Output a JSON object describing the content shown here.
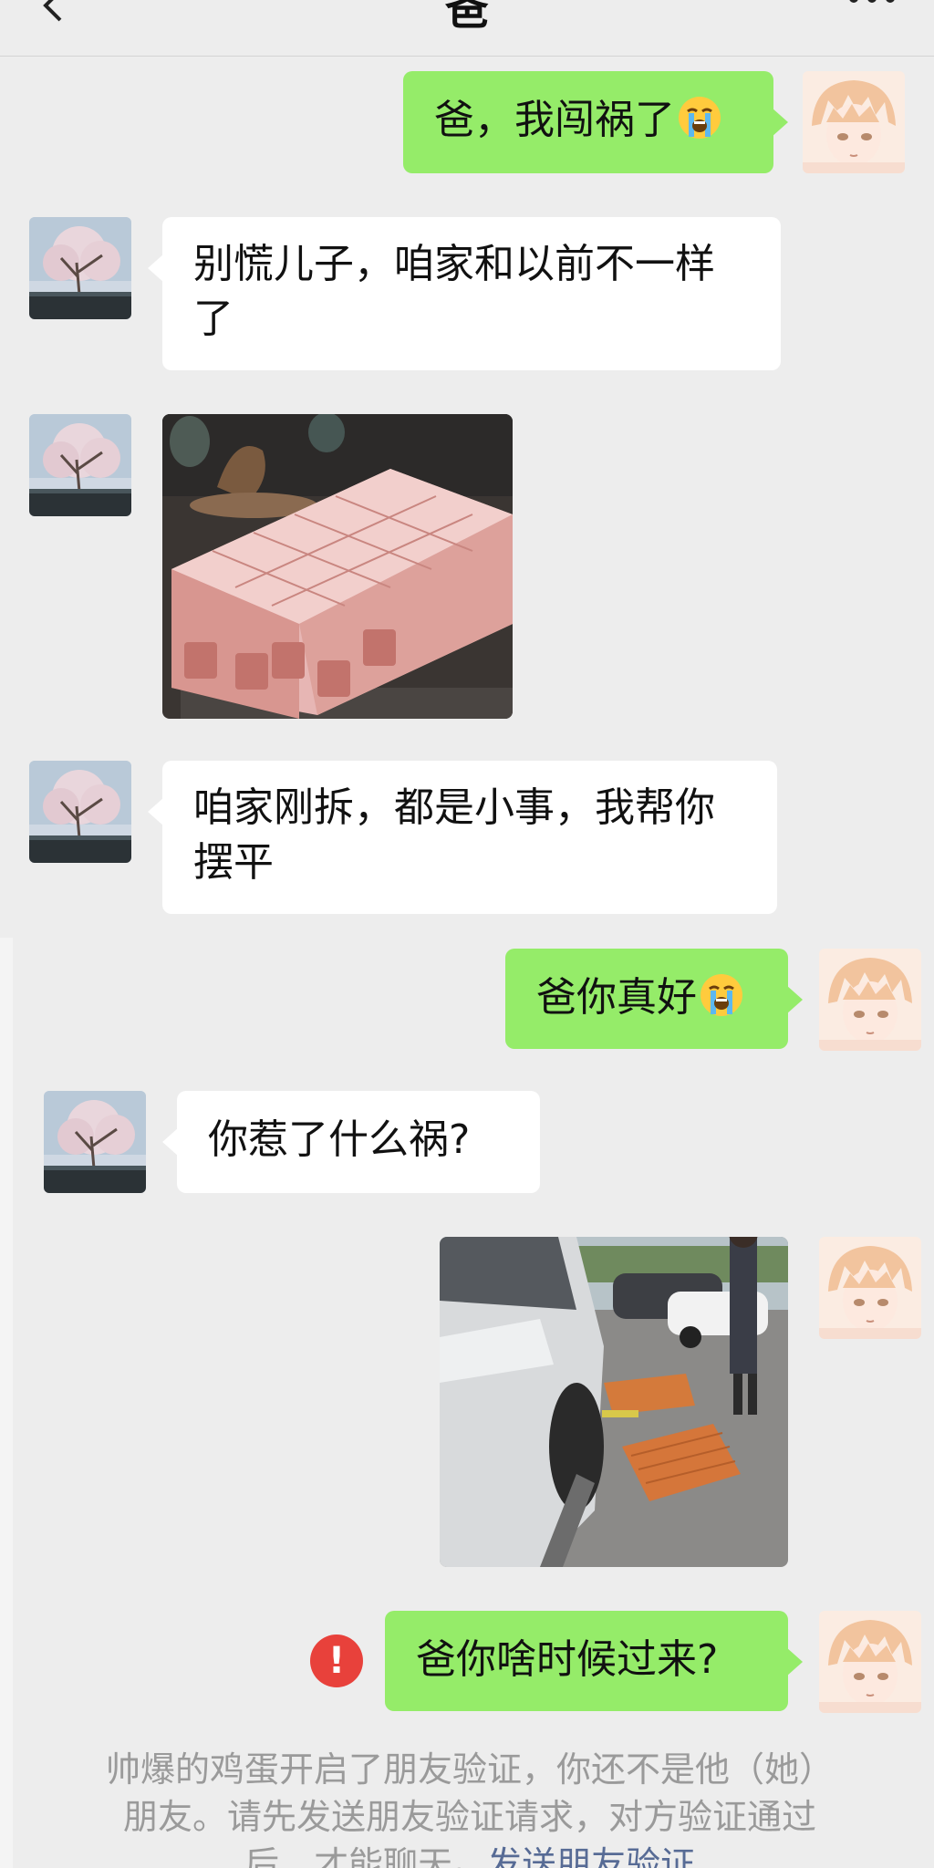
{
  "header": {
    "title": "爸",
    "back_icon": "chevron-left-icon",
    "more_icon": "ellipsis-icon"
  },
  "messages": [
    {
      "side": "right",
      "text": "爸，我闯祸了",
      "emoji": "loudly-crying-face"
    },
    {
      "side": "left",
      "text": "别慌儿子，咱家和以前不一样了"
    },
    {
      "side": "left",
      "type": "image",
      "image": "stacks-of-100-yuan-banknotes-photo"
    },
    {
      "side": "left",
      "text": "咱家刚拆，都是小事，我帮你摆平"
    },
    {
      "side": "right",
      "text": "爸你真好",
      "emoji": "loudly-crying-face"
    },
    {
      "side": "left",
      "text": "你惹了什么祸?"
    },
    {
      "side": "right",
      "type": "image",
      "image": "car-collision-with-bricks-photo"
    },
    {
      "side": "right",
      "text": "爸你啥时候过来?",
      "status": "failed"
    }
  ],
  "system_notice": {
    "text": "帅爆的鸡蛋开启了朋友验证，你还不是他（她）朋友。请先发送朋友验证请求，对方验证通过后，才能聊天。",
    "link": "发送朋友验证"
  },
  "colors": {
    "background": "#ededed",
    "bubble_self": "#95ec69",
    "bubble_other": "#ffffff",
    "error": "#e8413b",
    "link": "#576b95"
  }
}
